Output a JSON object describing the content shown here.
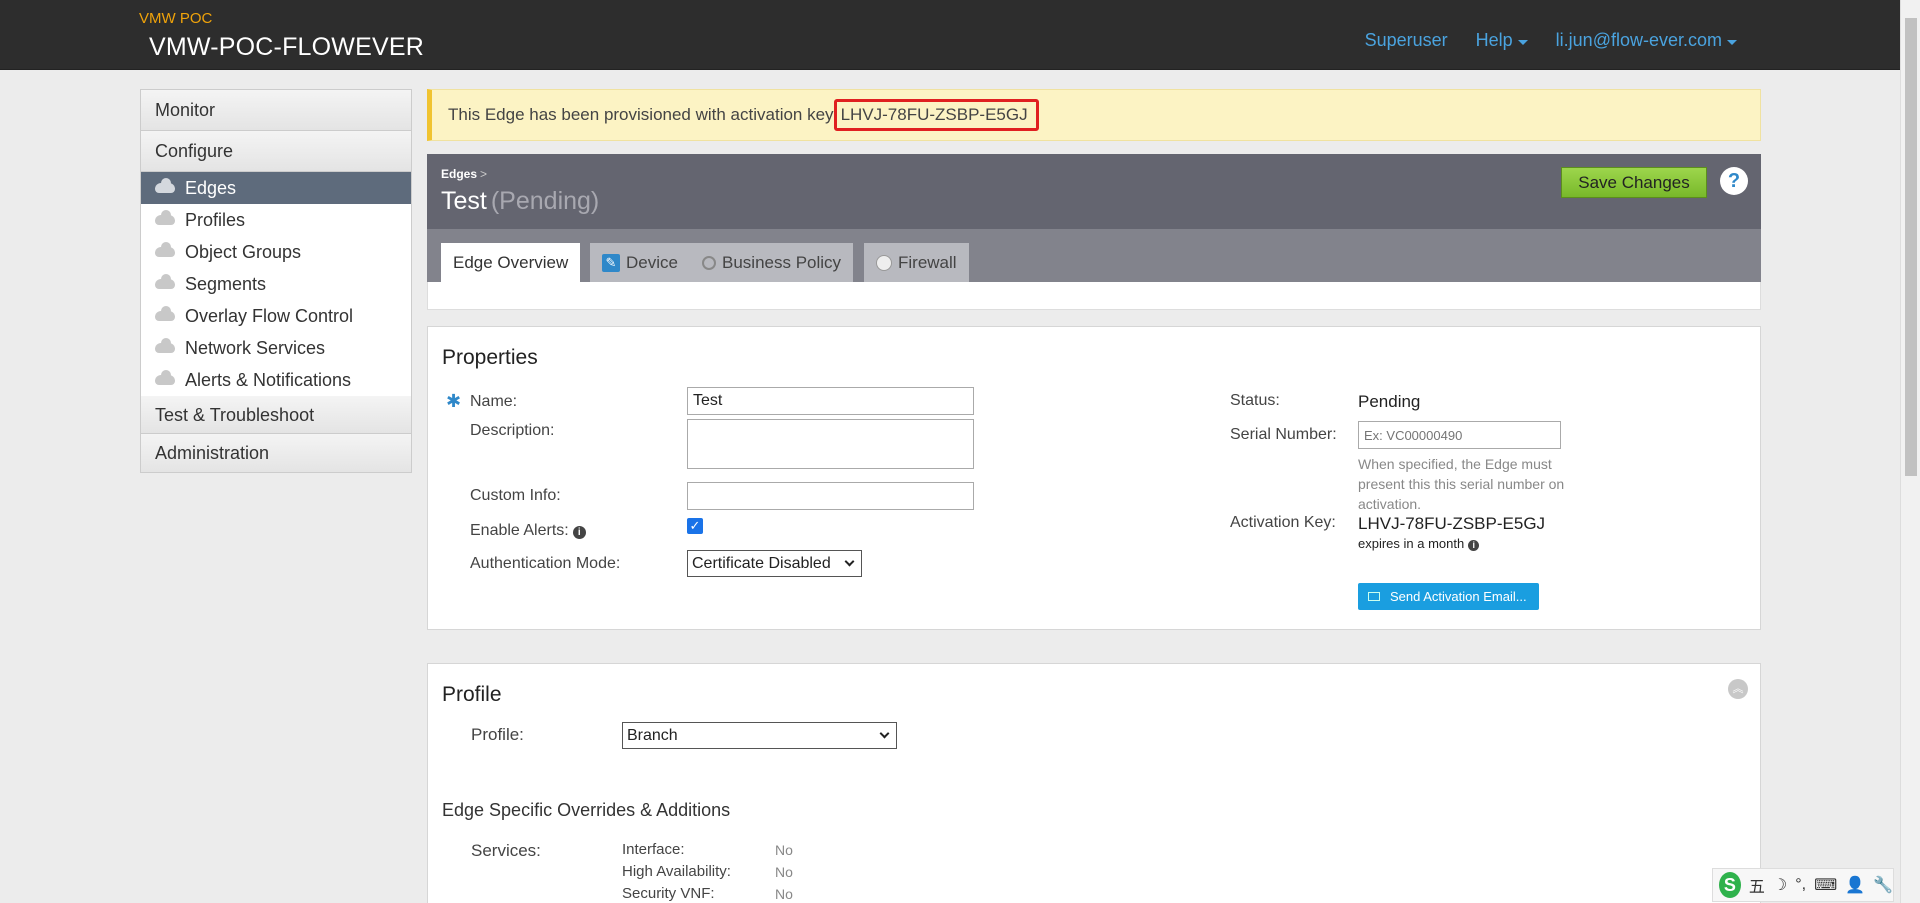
{
  "header": {
    "org_subtitle": "VMW POC",
    "org_name": "VMW-POC-FLOWEVER",
    "nav": {
      "superuser": "Superuser",
      "help": "Help",
      "user": "li.jun@flow-ever.com"
    }
  },
  "sidebar": {
    "monitor": "Monitor",
    "configure": "Configure",
    "configure_items": [
      "Edges",
      "Profiles",
      "Object Groups",
      "Segments",
      "Overlay Flow Control",
      "Network Services",
      "Alerts & Notifications"
    ],
    "test_troubleshoot": "Test & Troubleshoot",
    "administration": "Administration"
  },
  "alert": {
    "message": "This Edge has been provisioned with activation key",
    "key": "LHVJ-78FU-ZSBP-E5GJ"
  },
  "page": {
    "breadcrumb": "Edges",
    "breadcrumb_sep": ">",
    "title": "Test",
    "status_tag": "(Pending)",
    "save_label": "Save Changes",
    "help_label": "?"
  },
  "tabs": [
    "Edge Overview",
    "Device",
    "Business Policy",
    "Firewall"
  ],
  "properties": {
    "heading": "Properties",
    "name_label": "Name:",
    "name_value": "Test",
    "description_label": "Description:",
    "custom_info_label": "Custom Info:",
    "enable_alerts_label": "Enable Alerts:",
    "enable_alerts_checked": true,
    "auth_mode_label": "Authentication Mode:",
    "auth_mode_value": "Certificate Disabled",
    "status_label": "Status:",
    "status_value": "Pending",
    "serial_label": "Serial Number:",
    "serial_placeholder": "Ex: VC00000490",
    "serial_hint": "When specified, the Edge must present this this serial number on activation.",
    "activation_key_label": "Activation Key:",
    "activation_key_value": "LHVJ-78FU-ZSBP-E5GJ",
    "expires_text": "expires in a month",
    "send_email_label": "Send Activation Email..."
  },
  "profile": {
    "heading": "Profile",
    "profile_label": "Profile:",
    "profile_value": "Branch",
    "overrides_heading": "Edge Specific Overrides & Additions",
    "services_label": "Services:",
    "services": [
      {
        "name": "Interface:",
        "value": "No"
      },
      {
        "name": "High Availability:",
        "value": "No"
      },
      {
        "name": "Security VNF:",
        "value": "No"
      }
    ]
  },
  "ime": {
    "s": "S",
    "five": "五",
    "moon": "☽",
    "punct": "°,",
    "keyboard": "⌨",
    "person": "👤",
    "tool": "🔧"
  },
  "colors": {
    "header_bg": "#2d2d2d",
    "accent_blue": "#4aa3df",
    "save_green": "#78b82a",
    "alert_bg": "#fcf3c4"
  }
}
